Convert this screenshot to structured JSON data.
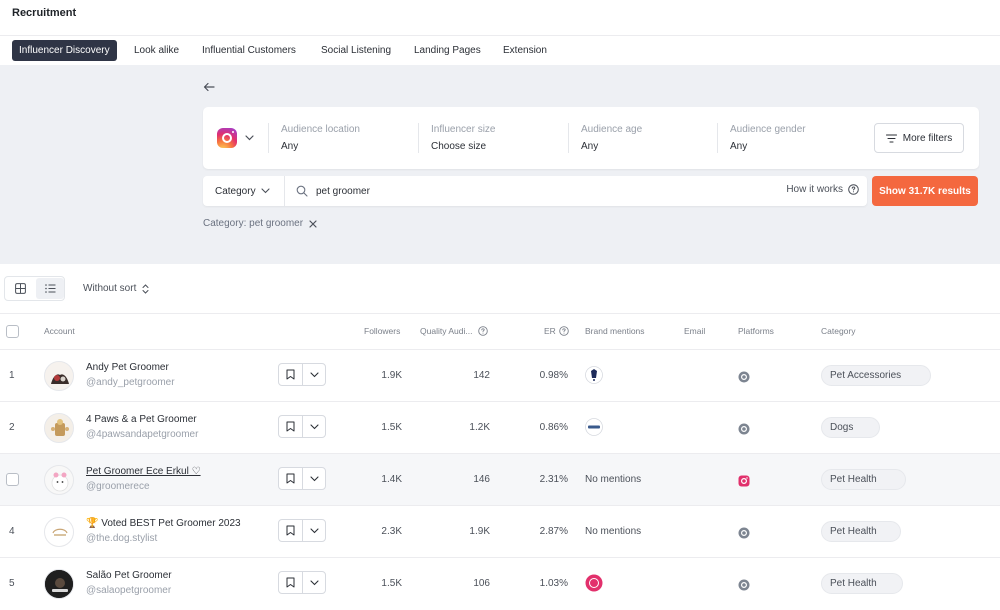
{
  "app": {
    "title": "Recruitment"
  },
  "tabs": [
    {
      "label": "Influencer Discovery",
      "active": true
    },
    {
      "label": "Look alike"
    },
    {
      "label": "Influential Customers"
    },
    {
      "label": "Social Listening"
    },
    {
      "label": "Landing Pages"
    },
    {
      "label": "Extension"
    }
  ],
  "filters": {
    "platform_icon": "instagram-icon",
    "fields": [
      {
        "label": "Audience location",
        "value": "Any"
      },
      {
        "label": "Influencer size",
        "value": "Choose size"
      },
      {
        "label": "Audience age",
        "value": "Any"
      },
      {
        "label": "Audience gender",
        "value": "Any"
      }
    ],
    "more_filters_label": "More filters"
  },
  "search": {
    "category_label": "Category",
    "query": "pet groomer",
    "how_it_works_label": "How it works",
    "show_results_label": "Show 31.7K results",
    "active_chip": "Category: pet groomer"
  },
  "toolbar": {
    "sort_label": "Without sort",
    "view_mode": "list"
  },
  "table": {
    "headers": {
      "account": "Account",
      "followers": "Followers",
      "quality": "Quality Audi...",
      "er": "ER",
      "brand_mentions": "Brand mentions",
      "email": "Email",
      "platforms": "Platforms",
      "category": "Category"
    },
    "rows": [
      {
        "index": "1",
        "name": "Andy Pet Groomer",
        "handle": "@andy_petgroomer",
        "followers": "1.9K",
        "quality": "142",
        "er": "0.98%",
        "mentions": "",
        "platform": "instagram-gray",
        "category": "Pet Accessories"
      },
      {
        "index": "2",
        "name": "4 Paws & a Pet Groomer",
        "handle": "@4pawsandapetgroomer",
        "followers": "1.5K",
        "quality": "1.2K",
        "er": "0.86%",
        "mentions": "",
        "platform": "instagram-gray",
        "category": "Dogs"
      },
      {
        "index": "",
        "name": "Pet Groomer Ece Erkul ♡",
        "handle": "@groomerece",
        "followers": "1.4K",
        "quality": "146",
        "er": "2.31%",
        "mentions": "No mentions",
        "platform": "instagram-color",
        "category": "Pet Health"
      },
      {
        "index": "4",
        "name": "🏆 Voted BEST Pet Groomer 2023",
        "handle": "@the.dog.stylist",
        "followers": "2.3K",
        "quality": "1.9K",
        "er": "2.87%",
        "mentions": "No mentions",
        "platform": "instagram-gray",
        "category": "Pet Health"
      },
      {
        "index": "5",
        "name": "Salão Pet Groomer",
        "handle": "@salaopetgroomer",
        "followers": "1.5K",
        "quality": "106",
        "er": "1.03%",
        "mentions": "",
        "platform": "instagram-gray",
        "category": "Pet Health"
      }
    ]
  },
  "colors": {
    "accent": "#f4683f",
    "active_tab": "#2f3546",
    "panel_bg": "#eef0f4"
  }
}
